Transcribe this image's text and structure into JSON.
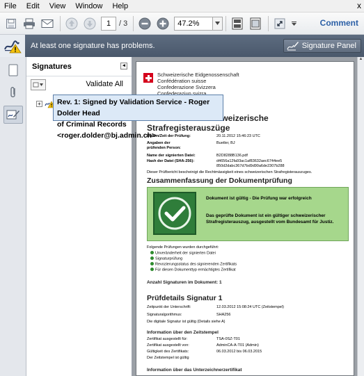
{
  "menu": {
    "items": [
      {
        "label": "File"
      },
      {
        "label": "Edit"
      },
      {
        "label": "View"
      },
      {
        "label": "Window"
      },
      {
        "label": "Help"
      }
    ],
    "close_glyph": "x"
  },
  "toolbar": {
    "current_page": "1",
    "page_total": "/ 3",
    "zoom": "47.2%",
    "comment_label": "Comment"
  },
  "sigbar": {
    "message": "At least one signature has problems.",
    "panel_button": "Signature Panel"
  },
  "sigpanel": {
    "title": "Signatures",
    "validate_all": "Validate All",
    "expander": "+"
  },
  "tooltip": {
    "line1": "Rev. 1: Signed by Validation Service - Roger Dolder  Head",
    "line2": "of Criminal Records <roger.dolder@bj.admin.ch>"
  },
  "document": {
    "federation": [
      "Schweizerische Eidgenossenschaft",
      "Confédération suisse",
      "Confederazione Svizzera",
      "Confederaziun svizra"
    ],
    "title": "Prüfbericht für schweizerische Strafregisterauszüge",
    "fields": [
      {
        "key": "Datum/Zeit der Prüfung:",
        "value": "20.11.2012 15:46:23 UTC"
      },
      {
        "key": "Angaben der prüfenden Person:",
        "value": "Buetler, BJ"
      },
      {
        "key": "Name der signierten Datei:",
        "value": "B2D8288B136.pdf"
      },
      {
        "key": "Hash der Datei (SHA-256):",
        "value": "d4656a12fa93ac1af83632aec6744ee5 850d2dabc367d7bd9d90a6de2307b288"
      }
    ],
    "confirm_text": "Dieser Prüfbericht bescheinigt die Rechtmässigkeit eines schweizerischen Strafregisterauszuges.",
    "summary_heading": "Zusammenfassung der Dokumentprüfung",
    "valid_line": "Dokument ist gültig - Die Prüfung war erfolgreich",
    "valid_detail": "Das geprüfte Dokument ist ein gültiger schweizerischer Strafregisterauszug, ausgestellt vom Bundesamt für Justiz.",
    "checks_intro": "Folgende Prüfungen wurden durchgeführt:",
    "checks": [
      "Unveränderheit der signierten Datei",
      "Signaturprüfung",
      "Revozierungsstatus des signierenden Zertifikats",
      "Für diesen Dokumenttyp ermächtigtes Zertifikat"
    ],
    "sig_count": "Anzahl Signaturen im Dokument: 1",
    "detail_heading": "Prüfdetails Signatur 1",
    "detail_fields": [
      {
        "key": "Zeitpunkt der Unterschrift:",
        "value": "12.03.2012 15:08:24 UTC (Zeitstempel)"
      },
      {
        "key": "Signaturalgorithmus:",
        "value": "SHA256"
      }
    ],
    "detail_note": "Die digitale Signatur ist gültig (Details siehe A)",
    "ts_heading": "Information über den Zeitstempel",
    "ts_fields": [
      {
        "key": "Zertifikat ausgestellt für:",
        "value": "TSA-0SZ-T01"
      },
      {
        "key": "Zertifikat ausgestellt von:",
        "value": "AdminCA-A-T01 (Admin)"
      },
      {
        "key": "Gültigkeit des Zertifikats:",
        "value": "06.03.2012 bis 06.03.2015"
      }
    ],
    "ts_note": "Der Zeitstempel ist gültig",
    "cert_heading": "Information über das Unterzeichnerzertifikat"
  }
}
